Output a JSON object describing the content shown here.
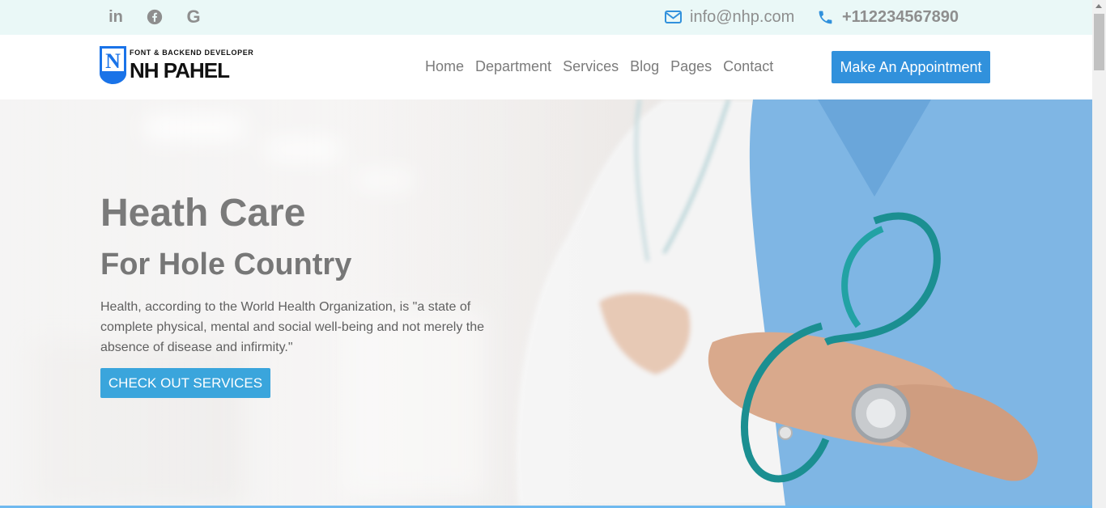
{
  "topbar": {
    "social": [
      {
        "icon": "linkedin-icon",
        "glyph": "in"
      },
      {
        "icon": "facebook-icon"
      },
      {
        "icon": "google-icon",
        "glyph": "G"
      }
    ],
    "email": "info@nhp.com",
    "phone": "+112234567890",
    "icon_color": "#3191dc"
  },
  "header": {
    "logo": {
      "letter": "N",
      "tagline": "FONT & BACKEND DEVELOPER",
      "name": "NH PAHEL"
    },
    "nav": [
      "Home",
      "Department",
      "Services",
      "Blog",
      "Pages",
      "Contact"
    ],
    "cta_label": "Make An Appointment"
  },
  "hero": {
    "title": "Heath Care",
    "subtitle": "For Hole Country",
    "description": "Health, according to the World Health Organization, is \"a state of complete physical, mental and social well-being and not merely the absence of disease and infirmity.\"",
    "button_label": "CHECK OUT SERVICES"
  },
  "colors": {
    "accent": "#3191dc",
    "topbar_bg": "#eaf8f7",
    "hero_button": "#3aa5dc",
    "muted_text": "#8e8e8e"
  }
}
